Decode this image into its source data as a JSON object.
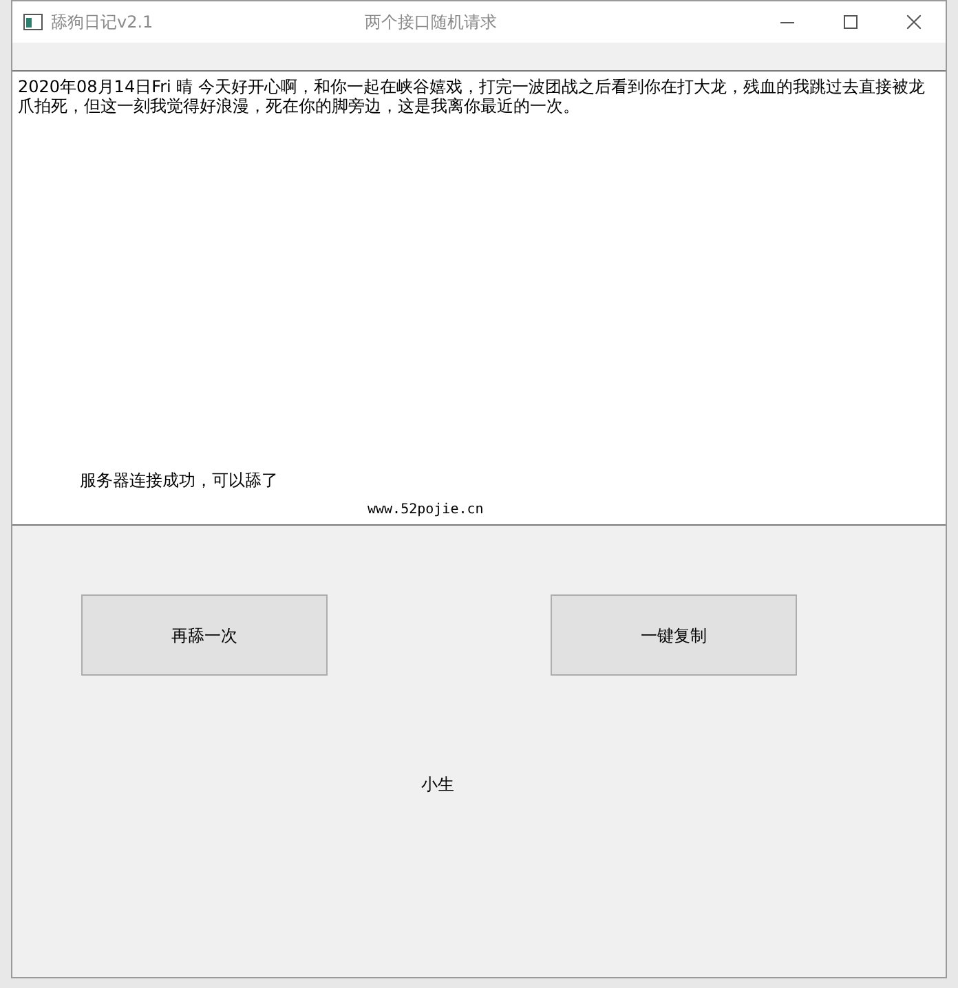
{
  "window": {
    "app_title": "舔狗日记v2.1",
    "caption": "两个接口随机请求"
  },
  "diary": {
    "text": "2020年08月14日Fri 晴 今天好开心啊，和你一起在峡谷嬉戏，打完一波团战之后看到你在打大龙，残血的我跳过去直接被龙爪拍死，但这一刻我觉得好浪漫，死在你的脚旁边，这是我离你最近的一次。",
    "status": "服务器连接成功，可以舔了",
    "site": "www.52pojie.cn"
  },
  "buttons": [
    {
      "label": "再舔一次"
    },
    {
      "label": "一键复制"
    }
  ],
  "author": "小生"
}
